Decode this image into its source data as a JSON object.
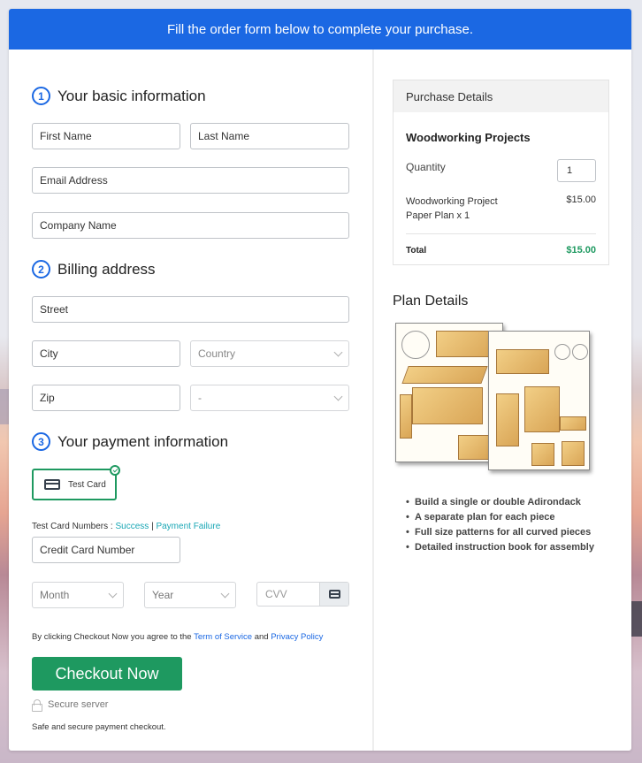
{
  "banner": {
    "text": "Fill the order form below to complete your purchase."
  },
  "form": {
    "sections": [
      {
        "number": "1",
        "title": "Your basic information"
      },
      {
        "number": "2",
        "title": "Billing address"
      },
      {
        "number": "3",
        "title": "Your payment information"
      }
    ],
    "basic": {
      "first_name_placeholder": "First Name",
      "last_name_placeholder": "Last Name",
      "email_placeholder": "Email Address",
      "company_placeholder": "Company Name"
    },
    "billing": {
      "street_placeholder": "Street",
      "city_placeholder": "City",
      "country_selected": "Country",
      "zip_placeholder": "Zip",
      "state_selected": "-"
    },
    "payment": {
      "method_label": "Test Card",
      "method_selected": true,
      "test_numbers_label": "Test Card Numbers :",
      "success_link": "Success",
      "separator": "|",
      "failure_link": "Payment Failure",
      "card_number_placeholder": "Credit Card Number",
      "month_selected": "Month",
      "year_selected": "Year",
      "cvv_placeholder": "CVV"
    },
    "terms": {
      "prefix": "By clicking Checkout Now you agree to the",
      "tos_link": "Term of Service",
      "and": "and",
      "privacy_link": "Privacy Policy"
    },
    "checkout_button": "Checkout Now",
    "secure_label": "Secure server",
    "safe_note": "Safe and secure payment checkout."
  },
  "purchase": {
    "header": "Purchase Details",
    "product": "Woodworking Projects",
    "quantity_label": "Quantity",
    "quantity": "1",
    "line_item": "Woodworking Project Paper Plan x 1",
    "line_price": "$15.00",
    "total_label": "Total",
    "total": "$15.00"
  },
  "plan": {
    "title": "Plan Details",
    "image_alt": "Woodworking plan sheets illustration",
    "features": [
      "Build a single or double Adirondack",
      "A separate plan for each piece",
      "Full size patterns for all curved pieces",
      "Detailed instruction book for assembly"
    ]
  },
  "colors": {
    "brand_blue": "#1b68e3",
    "success_green": "#1e9960",
    "link_teal": "#1aa7b5"
  }
}
